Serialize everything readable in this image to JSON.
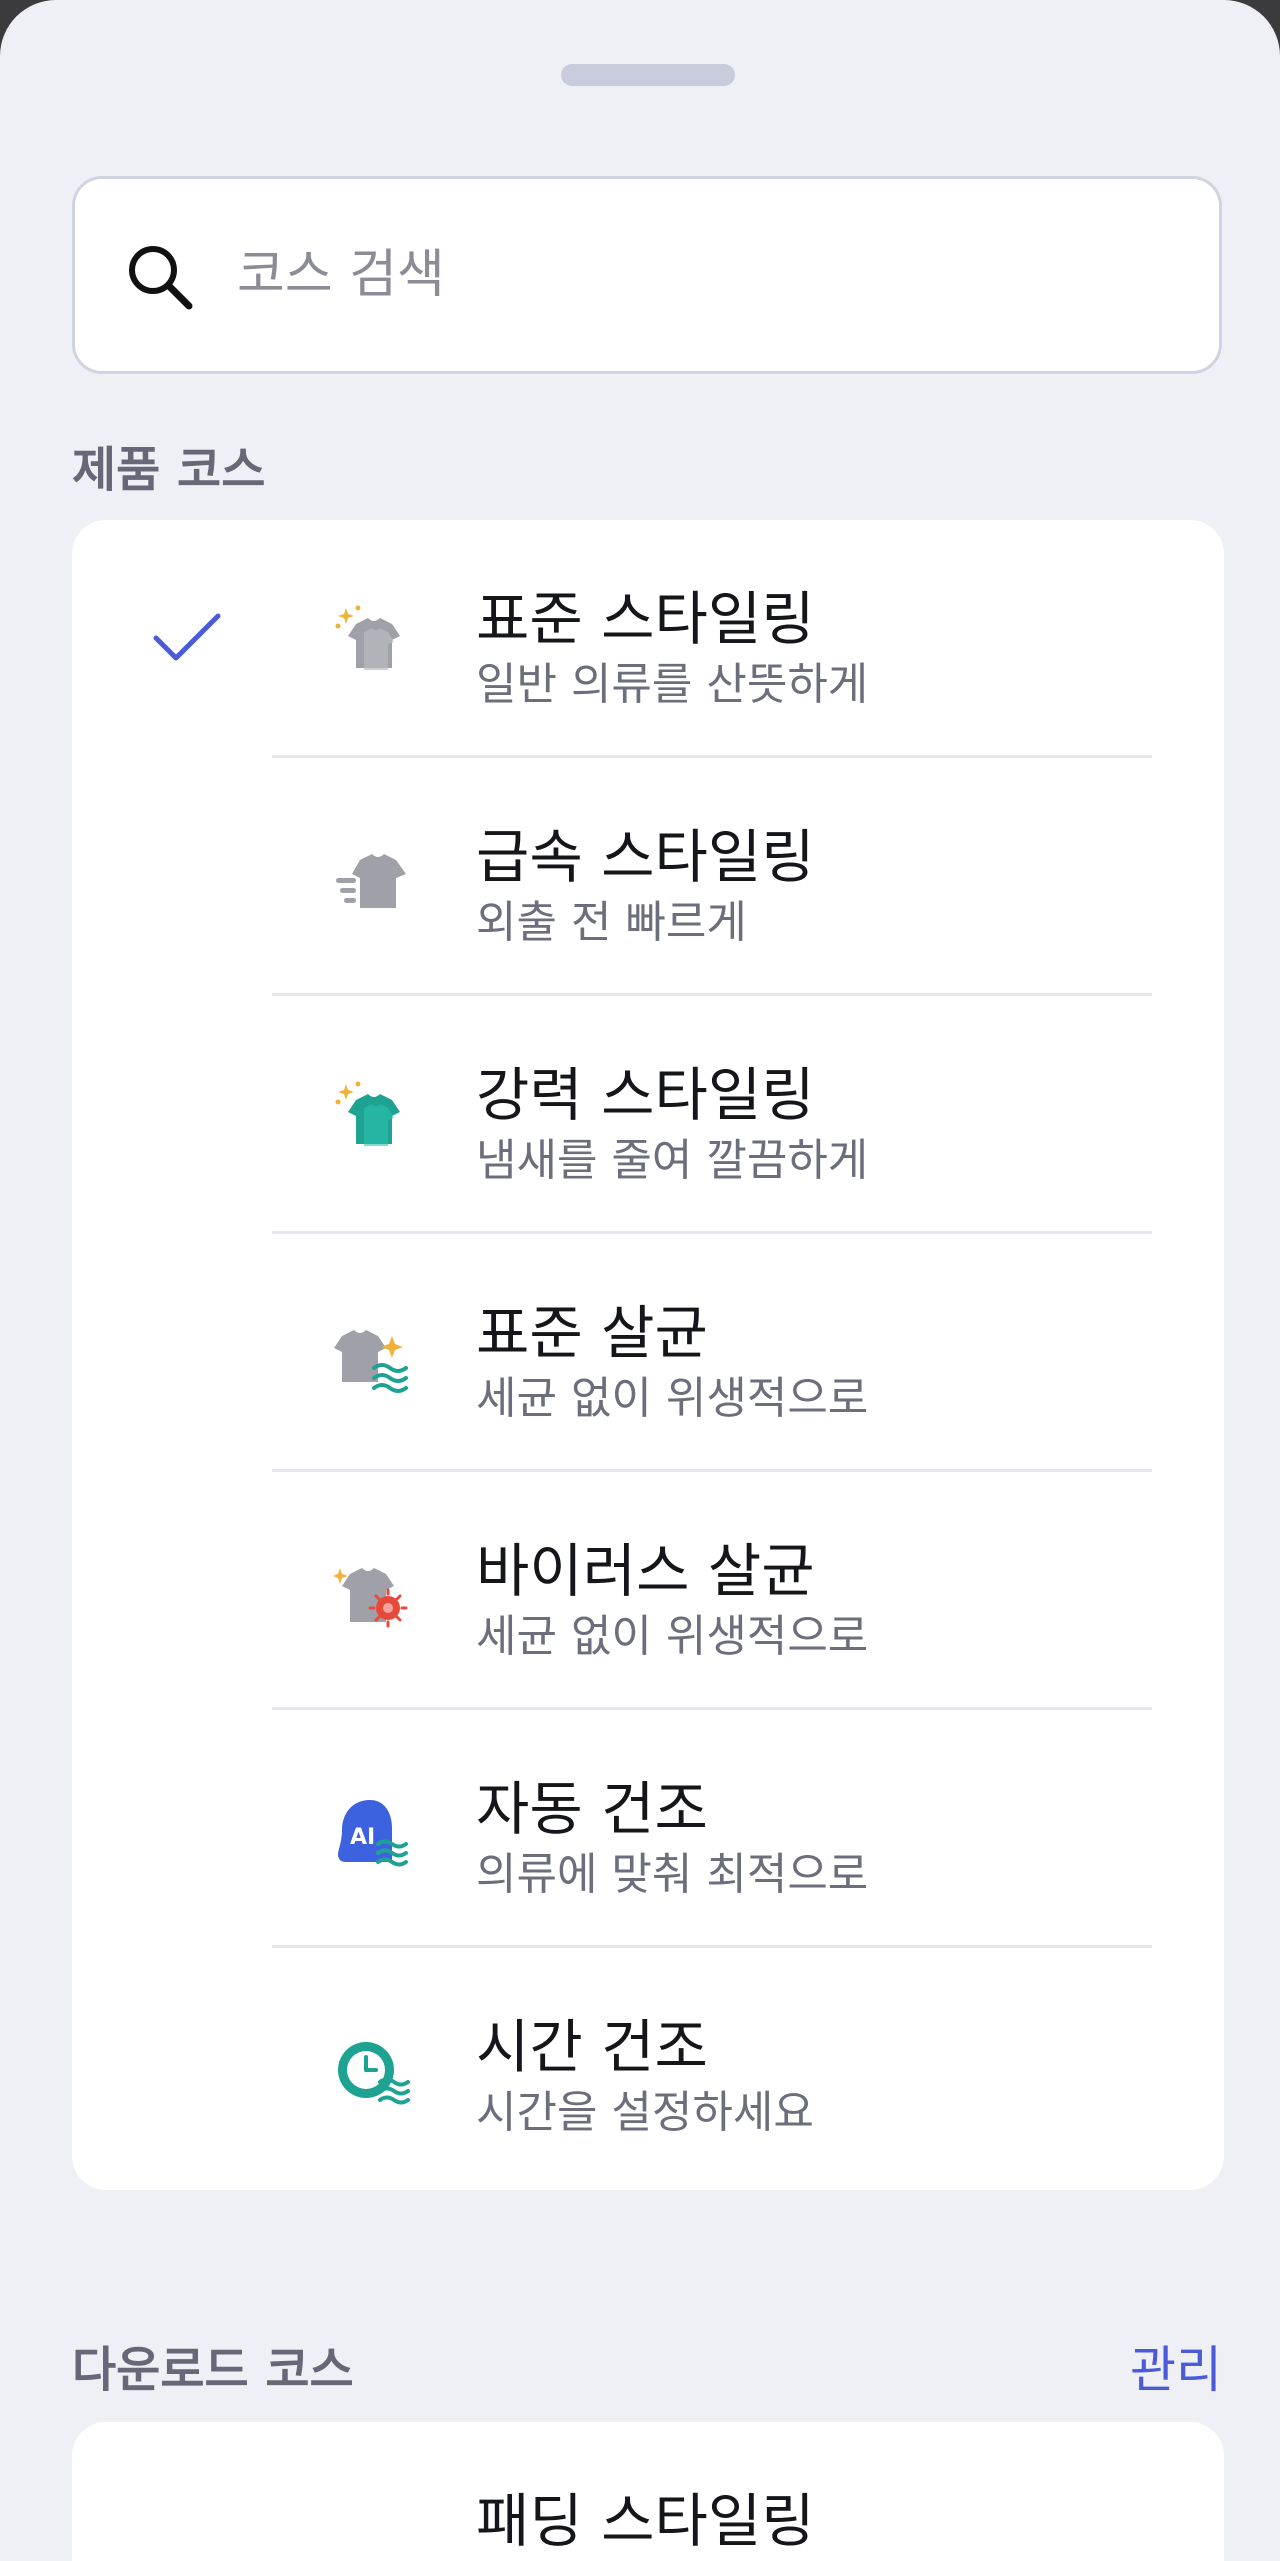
{
  "search": {
    "placeholder": "코스 검색",
    "icon": "search-icon"
  },
  "product_section": {
    "title": "제품 코스"
  },
  "courses": [
    {
      "name": "표준 스타일링",
      "desc": "일반 의류를 산뜻하게",
      "icon": "shirt-sparkle-icon",
      "selected": true
    },
    {
      "name": "급속 스타일링",
      "desc": "외출 전 빠르게",
      "icon": "shirt-speed-icon",
      "selected": false
    },
    {
      "name": "강력 스타일링",
      "desc": "냄새를 줄여 깔끔하게",
      "icon": "shirt-strong-icon",
      "selected": false
    },
    {
      "name": "표준 살균",
      "desc": "세균 없이 위생적으로",
      "icon": "shirt-sanitize-icon",
      "selected": false
    },
    {
      "name": "바이러스 살균",
      "desc": "세균 없이 위생적으로",
      "icon": "shirt-virus-icon",
      "selected": false
    },
    {
      "name": "자동 건조",
      "desc": "의류에 맞춰 최적으로",
      "icon": "ai-dry-icon",
      "selected": false
    },
    {
      "name": "시간 건조",
      "desc": "시간을 설정하세요",
      "icon": "timer-dry-icon",
      "selected": false
    }
  ],
  "download_section": {
    "title": "다운로드 코스",
    "manage_label": "관리"
  },
  "download_courses": [
    {
      "name": "패딩 스타일링"
    }
  ],
  "colors": {
    "accent": "#4a5ad8",
    "background": "#eff0f5",
    "card": "#ffffff",
    "teal": "#1ea393",
    "gray_icon": "#9fa0a8",
    "blue_icon": "#3d62e0",
    "sparkle": "#f0b23a"
  }
}
